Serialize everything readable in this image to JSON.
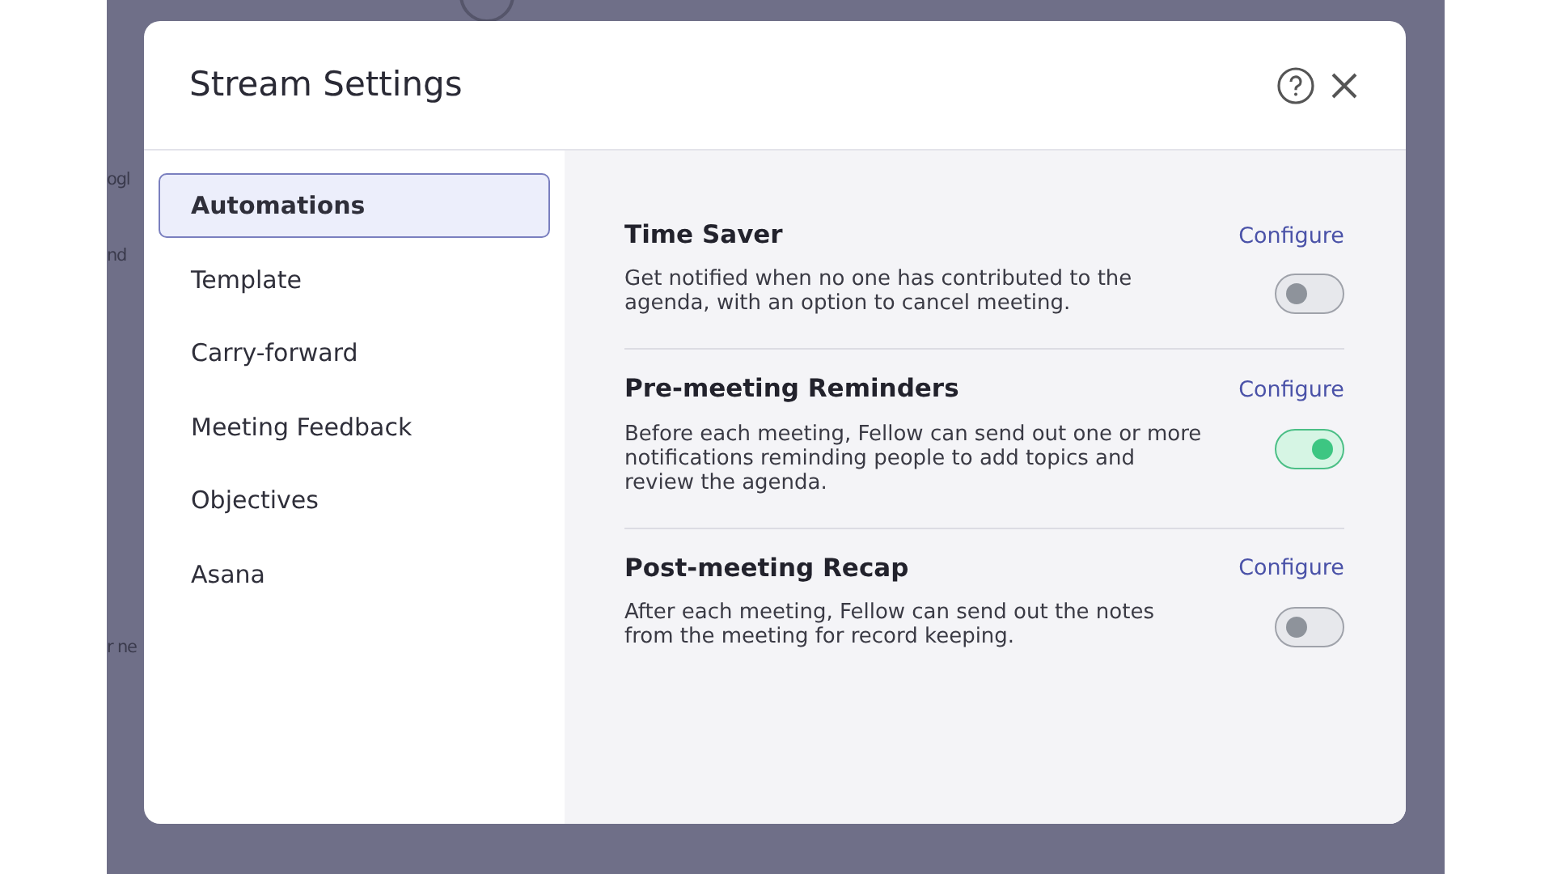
{
  "background": {
    "fragments": [
      "ogl",
      "nd",
      "r ne"
    ]
  },
  "dialog": {
    "title": "Stream Settings",
    "sidebar": {
      "items": [
        {
          "label": "Automations",
          "selected": true
        },
        {
          "label": "Template",
          "selected": false
        },
        {
          "label": "Carry-forward",
          "selected": false
        },
        {
          "label": "Meeting Feedback",
          "selected": false
        },
        {
          "label": "Objectives",
          "selected": false
        },
        {
          "label": "Asana",
          "selected": false
        }
      ]
    },
    "automations": [
      {
        "title": "Time Saver",
        "link": "Configure",
        "description": "Get notified when no one has contributed to the agenda, with an option to cancel meeting.",
        "on": false
      },
      {
        "title": "Pre-meeting Reminders",
        "link": "Configure",
        "description": "Before each meeting, Fellow can send out one or more notifications reminding people to add topics and review the agenda.",
        "on": true
      },
      {
        "title": "Post-meeting Recap",
        "link": "Configure",
        "description": "After each meeting, Fellow can send out the notes from the meeting for record keeping.",
        "on": false
      }
    ]
  }
}
